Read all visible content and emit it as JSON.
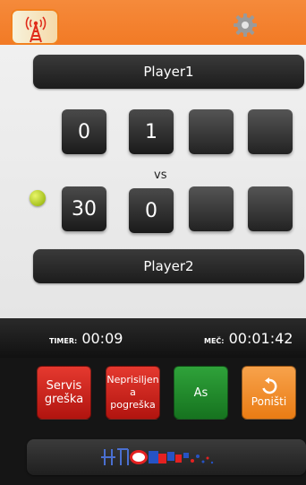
{
  "players": {
    "player1": "Player1",
    "player2": "Player2"
  },
  "scores": {
    "row1": [
      "0",
      "1",
      "",
      ""
    ],
    "row2": [
      "30",
      "0",
      "",
      ""
    ]
  },
  "vs_label": "vs",
  "timers": {
    "timer_label": "TIMER:",
    "timer_value": "00:09",
    "match_label": "MEČ:",
    "match_value": "00:01:42"
  },
  "actions": {
    "service_error": "Servis greška",
    "unforced_error": "Neprisiljen a pogreška",
    "ace": "As",
    "undo": "Poništi"
  },
  "icons": {
    "broadcast": "broadcast-tower-icon",
    "settings": "gear-icon",
    "serving": "tennis-ball-icon",
    "undo": "undo-icon",
    "logo": "hts-logo"
  },
  "colors": {
    "accent": "#f27a25",
    "red_btn": "#c81d16",
    "green_btn": "#1f8a2b",
    "orange_btn": "#f08d2c"
  }
}
